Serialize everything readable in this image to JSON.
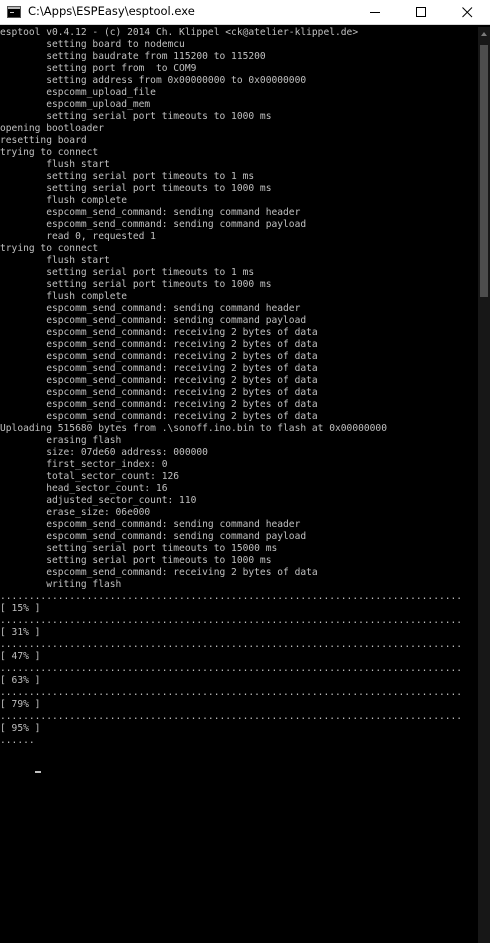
{
  "window": {
    "title": "C:\\Apps\\ESPEasy\\esptool.exe",
    "icons": {
      "app": "console-app-icon",
      "minimize": "minimize-icon",
      "maximize": "maximize-icon",
      "close": "close-icon"
    },
    "colors": {
      "titlebar": "#ffffff",
      "console_background": "#000000",
      "console_text": "#c0c0c0"
    }
  },
  "console": {
    "lines": [
      "esptool v0.4.12 - (c) 2014 Ch. Klippel <ck@atelier-klippel.de>",
      "        setting board to nodemcu",
      "        setting baudrate from 115200 to 115200",
      "        setting port from  to COM9",
      "        setting address from 0x00000000 to 0x00000000",
      "        espcomm_upload_file",
      "        espcomm_upload_mem",
      "        setting serial port timeouts to 1000 ms",
      "opening bootloader",
      "resetting board",
      "trying to connect",
      "        flush start",
      "        setting serial port timeouts to 1 ms",
      "        setting serial port timeouts to 1000 ms",
      "        flush complete",
      "        espcomm_send_command: sending command header",
      "        espcomm_send_command: sending command payload",
      "        read 0, requested 1",
      "trying to connect",
      "        flush start",
      "        setting serial port timeouts to 1 ms",
      "        setting serial port timeouts to 1000 ms",
      "        flush complete",
      "        espcomm_send_command: sending command header",
      "        espcomm_send_command: sending command payload",
      "        espcomm_send_command: receiving 2 bytes of data",
      "        espcomm_send_command: receiving 2 bytes of data",
      "        espcomm_send_command: receiving 2 bytes of data",
      "        espcomm_send_command: receiving 2 bytes of data",
      "        espcomm_send_command: receiving 2 bytes of data",
      "        espcomm_send_command: receiving 2 bytes of data",
      "        espcomm_send_command: receiving 2 bytes of data",
      "        espcomm_send_command: receiving 2 bytes of data",
      "Uploading 515680 bytes from .\\sonoff.ino.bin to flash at 0x00000000",
      "        erasing flash",
      "        size: 07de60 address: 000000",
      "        first_sector_index: 0",
      "        total_sector_count: 126",
      "        head_sector_count: 16",
      "        adjusted_sector_count: 110",
      "        erase_size: 06e000",
      "        espcomm_send_command: sending command header",
      "        espcomm_send_command: sending command payload",
      "        setting serial port timeouts to 15000 ms",
      "        setting serial port timeouts to 1000 ms",
      "        espcomm_send_command: receiving 2 bytes of data",
      "        writing flash",
      "................................................................................",
      "[ 15% ]",
      "................................................................................",
      "[ 31% ]",
      "................................................................................",
      "[ 47% ]",
      "................................................................................",
      "[ 63% ]",
      "................................................................................",
      "[ 79% ]",
      "................................................................................",
      "[ 95% ]",
      "......"
    ]
  }
}
